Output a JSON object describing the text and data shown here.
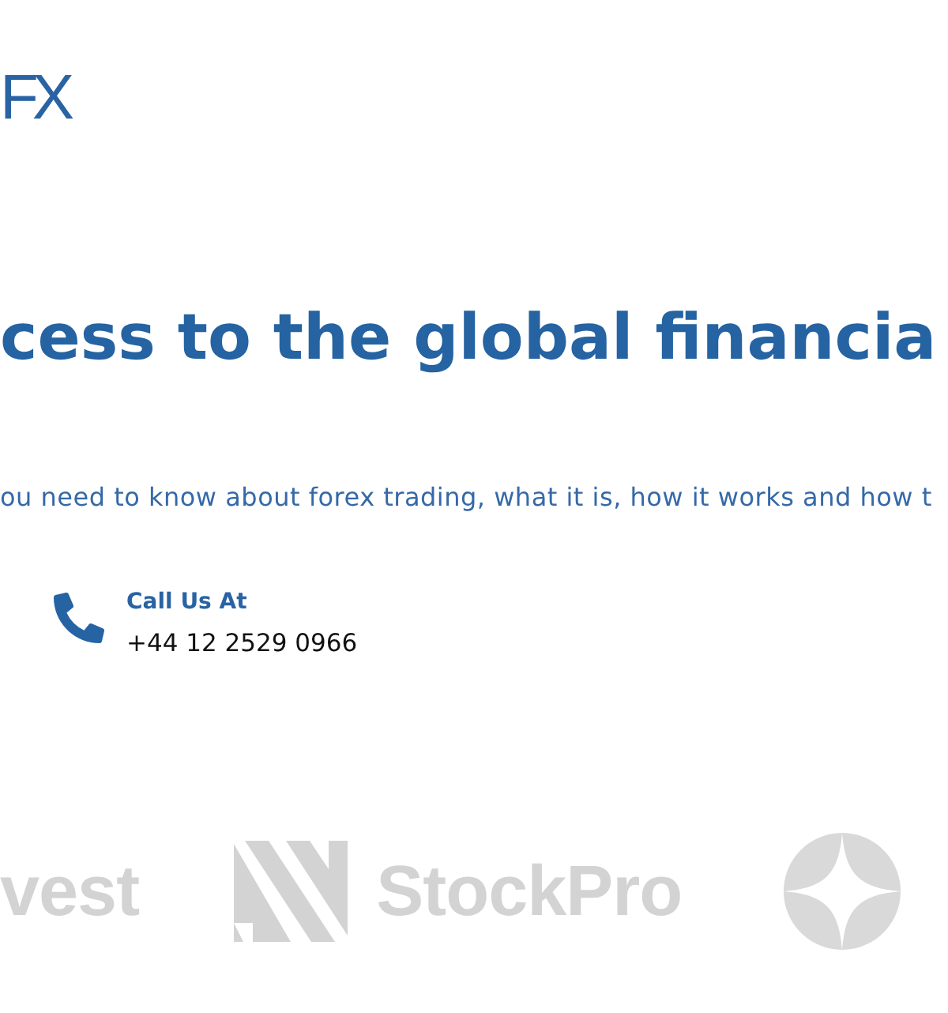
{
  "header": {
    "logo": "FX"
  },
  "hero": {
    "title": "cess to the global financia",
    "subtitle": "ou need to know about forex trading, what it is, how it works and how t"
  },
  "contact": {
    "label": "Call Us At",
    "phone": "+44 12 2529 0966"
  },
  "partners": [
    {
      "kind": "wordmark",
      "name": "vest"
    },
    {
      "kind": "stripes",
      "name": "StockPro"
    },
    {
      "kind": "star-circle"
    }
  ]
}
